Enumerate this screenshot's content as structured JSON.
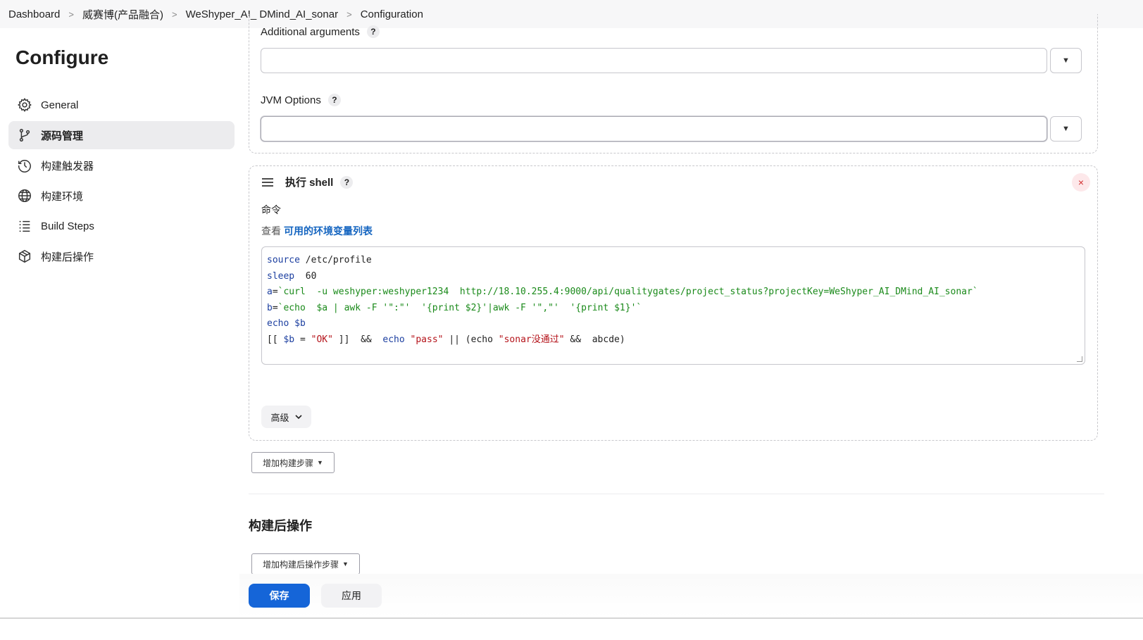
{
  "breadcrumb": {
    "items": [
      "Dashboard",
      "威赛博(产品融合)",
      "WeShyper_AI_ DMind_AI_sonar",
      "Configuration"
    ],
    "separator": ">"
  },
  "sidebar": {
    "title": "Configure",
    "items": [
      {
        "label": "General",
        "icon": "gear-icon"
      },
      {
        "label": "源码管理",
        "icon": "branch-icon",
        "active": true
      },
      {
        "label": "构建触发器",
        "icon": "clock-icon"
      },
      {
        "label": "构建环境",
        "icon": "globe-icon"
      },
      {
        "label": "Build Steps",
        "icon": "list-icon"
      },
      {
        "label": "构建后操作",
        "icon": "package-icon"
      }
    ]
  },
  "sonar_section": {
    "additional_arguments_label": "Additional arguments",
    "additional_arguments_value": "",
    "jvm_options_label": "JVM Options",
    "jvm_options_value": "",
    "help_glyph": "?",
    "dropdown_glyph": "▼"
  },
  "shell_step": {
    "title": "执行 shell",
    "close_glyph": "×",
    "command_label": "命令",
    "env_prefix": "查看",
    "env_link": "可用的环境变量列表",
    "code_lines": [
      "source /etc/profile",
      "sleep  60",
      "a=`curl  -u weshyper:weshyper1234  http://18.10.255.4:9000/api/qualitygates/project_status?projectKey=WeShyper_AI_DMind_AI_sonar`",
      "b=`echo  $a | awk -F '\":\"'  '{print $2}'|awk -F '\",\"'  '{print $1}'`",
      "echo $b",
      "[[ $b = \"OK\" ]]  &&  echo \"pass\" || (echo \"sonar没通过\" &&  abcde)"
    ],
    "advanced_label": "高级"
  },
  "add_build_step_label": "增加构建步骤",
  "post_build": {
    "title": "构建后操作",
    "add_label": "增加构建后操作步骤"
  },
  "footer": {
    "save_label": "保存",
    "apply_label": "应用"
  },
  "colors": {
    "primary": "#1565d8",
    "link": "#1565c0",
    "close_red": "#d32f2f"
  }
}
